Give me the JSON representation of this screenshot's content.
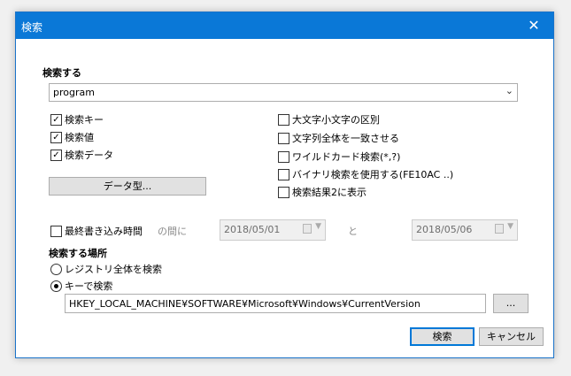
{
  "window": {
    "title": "検索",
    "close_label": "✕"
  },
  "search": {
    "heading": "検索する",
    "query": "program",
    "options_left": [
      {
        "label": "検索キー",
        "checked": true
      },
      {
        "label": "検索値",
        "checked": true
      },
      {
        "label": "検索データ",
        "checked": true
      }
    ],
    "options_right": [
      {
        "label": "大文字小文字の区別",
        "checked": false
      },
      {
        "label": "文字列全体を一致させる",
        "checked": false
      },
      {
        "label": "ワイルドカード検索(*,?)",
        "checked": false
      },
      {
        "label": "バイナリ検索を使用する(FE10AC ..)",
        "checked": false
      },
      {
        "label": "検索結果2に表示",
        "checked": false
      }
    ],
    "data_type_button": "データ型..."
  },
  "time_filter": {
    "label": "最終書き込み時間",
    "checked": false,
    "between_label": "の間に",
    "from": "2018/05/01",
    "and_label": "と",
    "to": "2018/05/06"
  },
  "location": {
    "heading": "検索する場所",
    "option_all": "レジストリ全体を検索",
    "option_key": "キーで検索",
    "selected": "key",
    "path": "HKEY_LOCAL_MACHINE¥SOFTWARE¥Microsoft¥Windows¥CurrentVersion",
    "browse_label": "..."
  },
  "actions": {
    "search": "検索",
    "cancel": "キャンセル"
  }
}
